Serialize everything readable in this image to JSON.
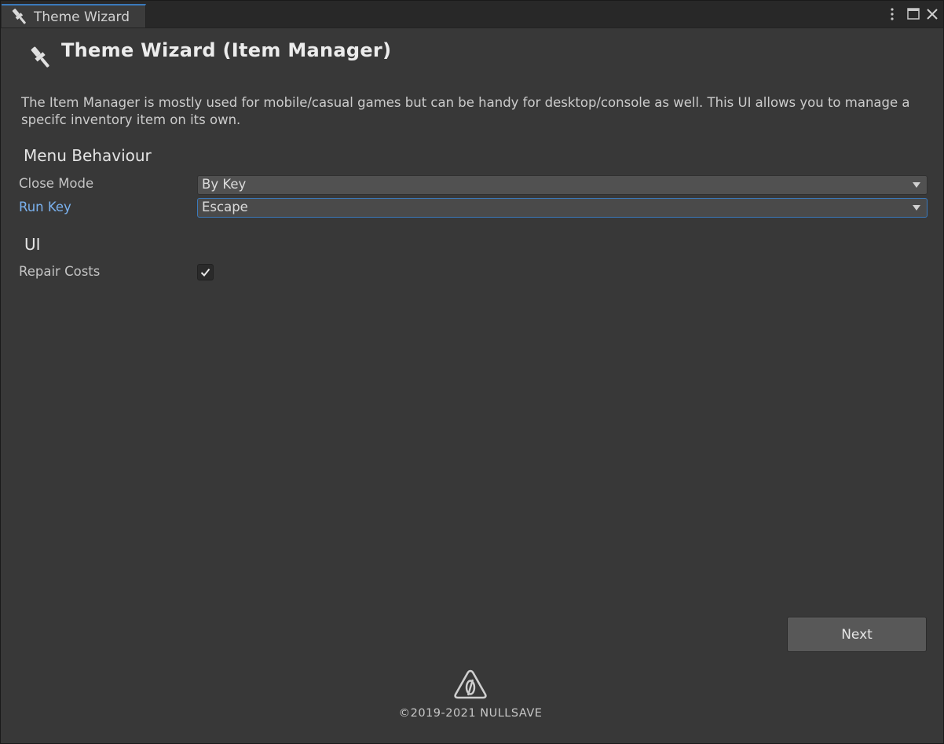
{
  "window": {
    "tab_title": "Theme Wizard",
    "controls": [
      "kebab-menu-icon",
      "maximize-icon",
      "close-icon"
    ]
  },
  "header": {
    "title": "Theme Wizard (Item Manager)",
    "icon": "paintbrush-icon"
  },
  "description": "The Item Manager is mostly used for mobile/casual games but can be handy for desktop/console as well. This UI allows you to manage a specifc inventory item on its own.",
  "sections": {
    "menu_behaviour": {
      "title": "Menu Behaviour",
      "close_mode": {
        "label": "Close Mode",
        "value": "By Key"
      },
      "run_key": {
        "label": "Run Key",
        "value": "Escape"
      }
    },
    "ui": {
      "title": "UI",
      "repair_costs": {
        "label": "Repair Costs",
        "checked": true
      }
    }
  },
  "footer": {
    "next_label": "Next",
    "copyright": "©2019-2021 NULLSAVE",
    "logo": "nullsave-logo-icon"
  },
  "colors": {
    "background": "#383838",
    "titlebar": "#282828",
    "accent": "#3a79bb",
    "focused_label": "#7ab1ee"
  }
}
